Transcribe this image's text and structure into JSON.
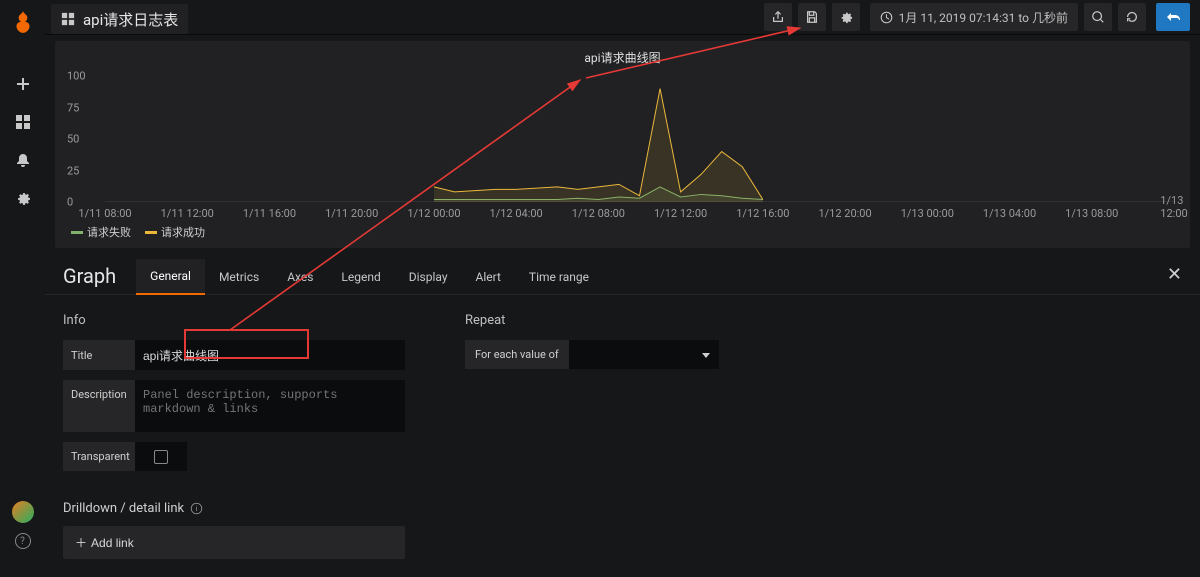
{
  "header": {
    "dashboard_title": "api请求日志表",
    "time_label": "1月 11, 2019 07:14:31 to 几秒前"
  },
  "panel": {
    "title": "api请求曲线图",
    "legend": [
      {
        "name": "请求失败",
        "color": "#7EB26D"
      },
      {
        "name": "请求成功",
        "color": "#EAB839"
      }
    ]
  },
  "chart_data": {
    "type": "line",
    "ylabel": "",
    "xlabel": "",
    "ylim": [
      0,
      100
    ],
    "yticks": [
      0,
      25,
      50,
      75,
      100
    ],
    "xticks": [
      "1/11 08:00",
      "1/11 12:00",
      "1/11 16:00",
      "1/11 20:00",
      "1/12 00:00",
      "1/12 04:00",
      "1/12 08:00",
      "1/12 12:00",
      "1/12 16:00",
      "1/12 20:00",
      "1/13 00:00",
      "1/13 04:00",
      "1/13 08:00",
      "1/13 12:00"
    ],
    "xrange": [
      8,
      60
    ],
    "series": [
      {
        "name": "请求失败",
        "color": "#7EB26D",
        "x": [
          24,
          25,
          30,
          31,
          32,
          33,
          34,
          35,
          36,
          37,
          38,
          39,
          40
        ],
        "values": [
          2,
          2,
          2,
          3,
          2,
          4,
          3,
          12,
          4,
          6,
          5,
          3,
          2
        ]
      },
      {
        "name": "请求成功",
        "color": "#EAB839",
        "x": [
          24,
          25,
          26,
          27,
          28,
          29,
          30,
          31,
          32,
          33,
          34,
          35,
          36,
          37,
          38,
          39,
          40
        ],
        "values": [
          12,
          8,
          9,
          10,
          10,
          11,
          12,
          10,
          12,
          14,
          5,
          90,
          8,
          22,
          40,
          28,
          2
        ]
      }
    ]
  },
  "editor": {
    "title": "Graph",
    "tabs": [
      "General",
      "Metrics",
      "Axes",
      "Legend",
      "Display",
      "Alert",
      "Time range"
    ],
    "active_tab": 0,
    "info_heading": "Info",
    "title_label": "Title",
    "title_value": "api请求曲线图",
    "desc_label": "Description",
    "desc_placeholder": "Panel description, supports markdown & links",
    "transparent_label": "Transparent",
    "repeat_heading": "Repeat",
    "repeat_label": "For each value of",
    "drilldown_heading": "Drilldown / detail link",
    "addlink_label": "Add link"
  },
  "icons": {
    "plus": "＋"
  }
}
